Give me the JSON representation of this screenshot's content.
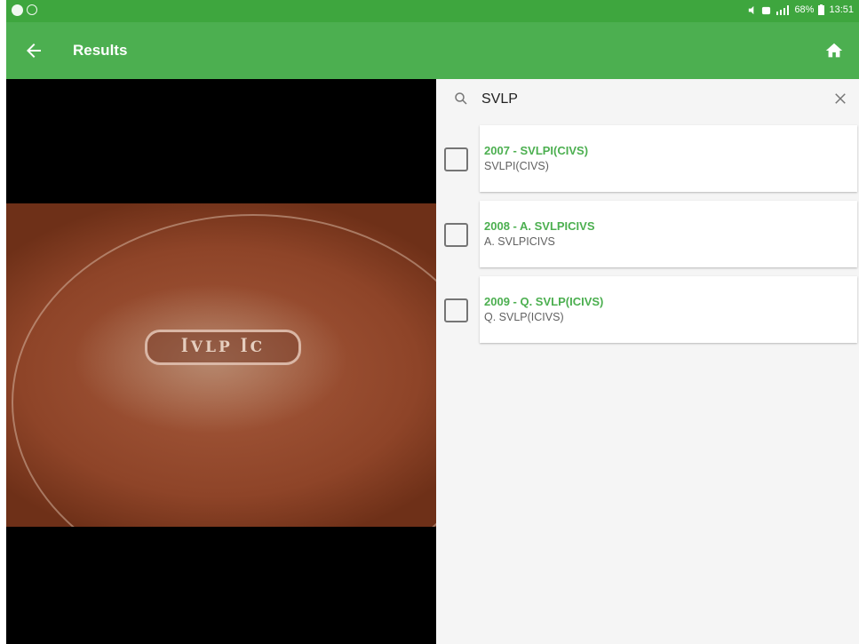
{
  "statusbar": {
    "battery": "68%",
    "time": "13:51"
  },
  "appbar": {
    "title": "Results",
    "back_icon": "arrow-left-icon",
    "home_icon": "home-icon"
  },
  "search": {
    "value": "SVLP"
  },
  "results": [
    {
      "title": "2007 - SVLPI(CIVS)",
      "subtitle": "SVLPI(CIVS)"
    },
    {
      "title": "2008 - A. SVLPICIVS",
      "subtitle": "A. SVLPICIVS"
    },
    {
      "title": "2009 - Q. SVLP(ICIVS)",
      "subtitle": "Q. SVLP(ICIVS)"
    }
  ],
  "colors": {
    "statusbar": "#3ea63e",
    "appbar": "#4caf50",
    "accent_text": "#4caf50"
  }
}
